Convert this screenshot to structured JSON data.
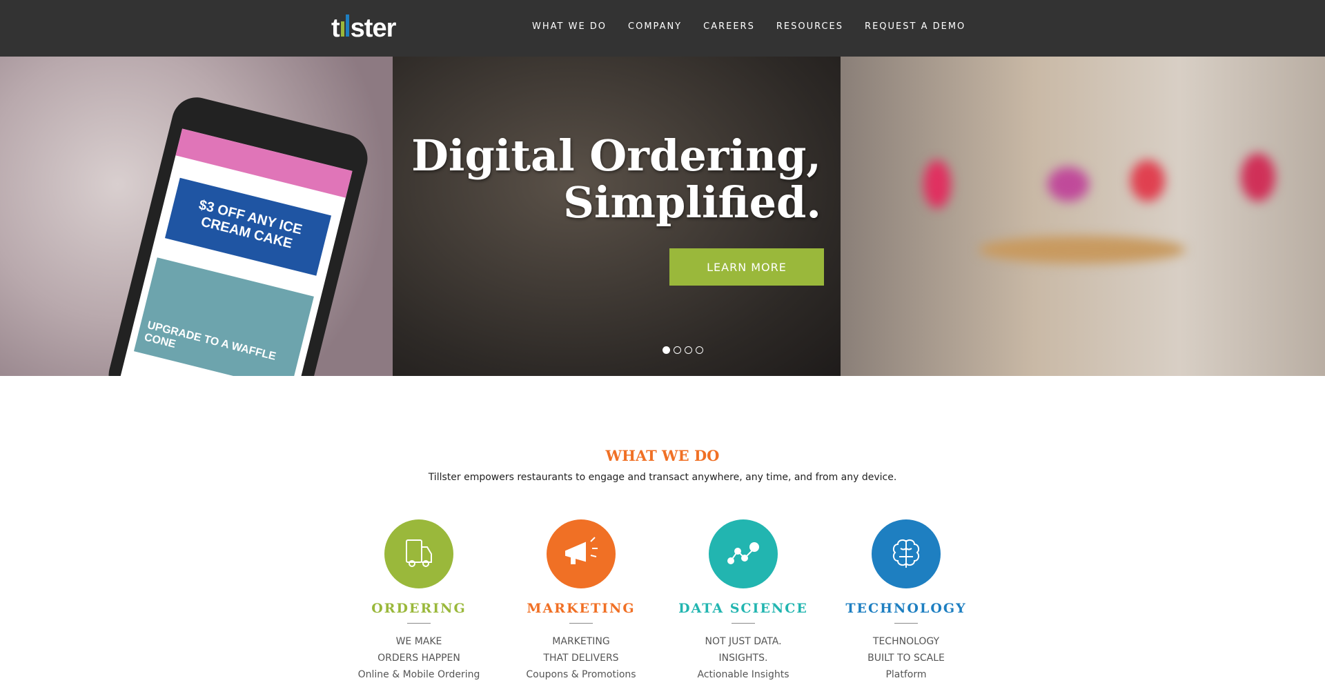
{
  "header": {
    "logo": "tillster",
    "nav": [
      "WHAT WE DO",
      "COMPANY",
      "CAREERS",
      "RESOURCES",
      "REQUEST A DEMO"
    ]
  },
  "hero": {
    "title_line1": "Digital Ordering,",
    "title_line2": "Simplified.",
    "cta": "LEARN MORE",
    "coupon": "$3 OFF ANY ICE CREAM CAKE",
    "promo": "UPGRADE TO A WAFFLE CONE",
    "slides": 4,
    "active_slide": 1
  },
  "section": {
    "title": "WHAT WE DO",
    "tagline": "Tillster empowers restaurants to engage and transact anywhere, any time, and from any device.",
    "items": [
      {
        "heading": "ORDERING",
        "lines": [
          "WE MAKE",
          "ORDERS HAPPEN",
          "Online & Mobile Ordering"
        ],
        "color": "#9ab83b",
        "icon": "truck-icon"
      },
      {
        "heading": "MARKETING",
        "lines": [
          "MARKETING",
          "THAT DELIVERS",
          "Coupons & Promotions"
        ],
        "color": "#f07025",
        "icon": "megaphone-icon"
      },
      {
        "heading": "DATA SCIENCE",
        "lines": [
          "NOT JUST DATA.",
          "INSIGHTS.",
          "Actionable Insights"
        ],
        "color": "#22b5b0",
        "icon": "data-graph-icon"
      },
      {
        "heading": "TECHNOLOGY",
        "lines": [
          "TECHNOLOGY",
          "BUILT TO SCALE",
          "Platform"
        ],
        "color": "#1e7fc1",
        "icon": "brain-icon"
      }
    ]
  }
}
